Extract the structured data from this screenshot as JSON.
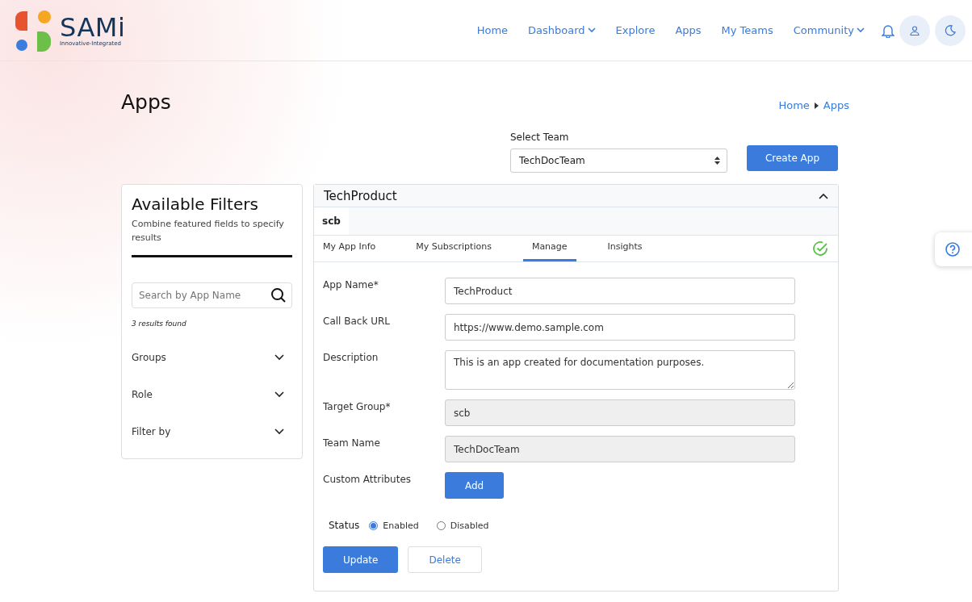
{
  "header": {
    "logo_name": "SAMi",
    "logo_tagline": "Innovative-Integrated",
    "nav": [
      {
        "label": "Home",
        "dropdown": false
      },
      {
        "label": "Dashboard",
        "dropdown": true
      },
      {
        "label": "Explore",
        "dropdown": false
      },
      {
        "label": "Apps",
        "dropdown": false
      },
      {
        "label": "My Teams",
        "dropdown": false
      },
      {
        "label": "Community",
        "dropdown": true
      }
    ]
  },
  "page": {
    "title": "Apps",
    "breadcrumb": [
      "Home",
      "Apps"
    ]
  },
  "team_select": {
    "label": "Select Team",
    "value": "TechDocTeam"
  },
  "create_button": "Create App",
  "filters": {
    "title": "Available Filters",
    "subtitle": "Combine featured fields to specify results",
    "search_placeholder": "Search by App Name",
    "results": "3 results found",
    "groups": [
      {
        "label": "Groups",
        "expanded": false
      },
      {
        "label": "Role",
        "expanded": false
      },
      {
        "label": "Filter by",
        "expanded": false
      }
    ]
  },
  "app": {
    "name": "TechProduct",
    "expanded": true,
    "group_tab": "scb",
    "tabs": [
      {
        "label": "My App Info",
        "selected": false
      },
      {
        "label": "My Subscriptions",
        "selected": false
      },
      {
        "label": "Manage",
        "selected": true
      },
      {
        "label": "Insights",
        "selected": false
      }
    ],
    "verified": true,
    "fields": [
      {
        "kind": "text",
        "label": "App Name*",
        "value": "TechProduct",
        "disabled": false
      },
      {
        "kind": "text",
        "label": "Call Back URL",
        "value": "https://www.demo.sample.com",
        "disabled": false
      },
      {
        "kind": "textarea",
        "label": "Description",
        "value": "This is an app created for documentation purposes.",
        "disabled": false
      },
      {
        "kind": "text",
        "label": "Target Group*",
        "value": "scb",
        "disabled": true
      },
      {
        "kind": "text",
        "label": "Team Name",
        "value": "TechDocTeam",
        "disabled": true
      },
      {
        "kind": "button",
        "label": "Custom Attributes",
        "value": "Add",
        "disabled": false
      }
    ],
    "status": {
      "label": "Status",
      "options": [
        {
          "label": "Enabled",
          "selected": true
        },
        {
          "label": "Disabled",
          "selected": false
        }
      ]
    },
    "update_button": "Update",
    "delete_button": "Delete"
  }
}
